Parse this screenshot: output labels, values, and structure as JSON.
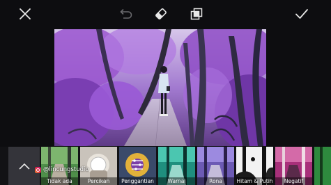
{
  "toolbar": {
    "close_icon": "close-icon",
    "undo_icon": "undo-icon",
    "eraser_icon": "eraser-icon",
    "layers_icon": "layers-icon",
    "apply_icon": "checkmark-icon"
  },
  "effects": {
    "collapse_icon": "chevron-up-icon",
    "items": [
      {
        "label": "Tidak ada"
      },
      {
        "label": "Percikan"
      },
      {
        "label": "Penggantian"
      },
      {
        "label": "Warnai"
      },
      {
        "label": "Rona"
      },
      {
        "label": "Hitam & Putih"
      },
      {
        "label": "Negatif"
      }
    ],
    "selected": "Penggantian"
  },
  "watermark": {
    "handle": "@lincungstudio"
  },
  "colors": {
    "accent": "#4e8fe0",
    "background": "#0d0d10",
    "photo_tint": "#8a4fc0"
  }
}
